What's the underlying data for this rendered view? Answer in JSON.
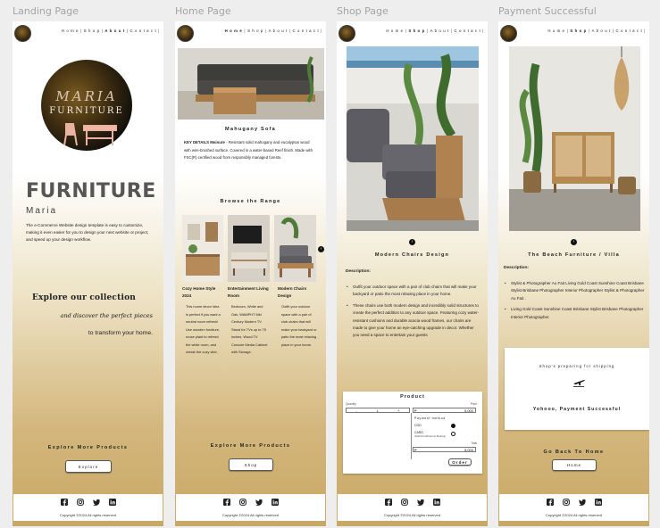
{
  "frames": {
    "landing_title": "Landing Page",
    "home_title": "Home Page",
    "shop_title": "Shop Page",
    "payment_title": "Payment Successful"
  },
  "nav": {
    "home": "H o m e",
    "shop": "S h o p",
    "about": "A b o u t",
    "contact": "C o n t a c t",
    "sep": "|"
  },
  "landing": {
    "logo_word1": "MARIA",
    "logo_word2": "FURNITURE",
    "title": "FURNITURE",
    "subtitle": "Maria",
    "intro": "The e-Commerce Website design template is easy to customize, making it even easier for you to design your next website or project, and speed up your design workflow.",
    "explore_heading": "Explore our collection",
    "explore_script": "and discover the perfect pieces",
    "explore_last": "to transform your home.",
    "more_products": "Explore More Products",
    "explore_button": "Explore"
  },
  "home": {
    "product_title": "Mahugany Sofa",
    "details_label": "KEY DETAILS Moinure",
    "details_text": "- Resistant solid mahogany and eucalyptus wood with wire-brushed surface. Covered in a water-based Reef finish. Made with FSC(R) certified wood from responsibly managed forests.",
    "browse_title": "Browse the Range",
    "col1_title": "Cozy Home Style 2024",
    "col1_text": "This home decor idea is perfect if you want a neutral room refresh! Use wooden furniture, rouse plant to refresh the white room, and create the cozy vibe.",
    "col2_title": "Entertainment Living Room",
    "col2_text": "Bedroom, White and Oak, WAMPHT Mid Century Modern TV Stand for TVs up to 75 inches, Wood TV Console Media Cabinet with Storage.",
    "col3_title": "Modern Chairs Design",
    "col3_text": "Outfit your outdoor space with a pair of club chairs that will make your backyard or patio the most relaxing place in your home.",
    "more_products": "Explore More Products",
    "shop_button": "Shop"
  },
  "shop": {
    "product_title": "Modern Chairs Design",
    "desc_label": "Description:",
    "bullet1": "Outfit your outdoor space with a pair of club chairs that will make your backyard or patio the most relaxing place in your home.",
    "bullet2": "These chairs use both modern design and incredibly solid structures to create the perfect addition to any outdoor space. Featuring cozy water-resistant cushions and durable acacia wood frames, our chairs are made to give your home an eye-catching upgrade in decor. Whether you need a space to entertain your guests",
    "order": {
      "title": "Product",
      "quantity_label": "Quantity",
      "price_label": "Price",
      "minus": "-",
      "qty": "1",
      "plus": "+",
      "price_value": "5,000",
      "payment_label": "Payment method",
      "cod": "COD",
      "card": "CARD",
      "card_sub": "(Debit/Credit/Internet Banking)",
      "total_label": "Total",
      "total_value": "5,000",
      "currency": "₱",
      "order_button": "Order"
    }
  },
  "payment": {
    "product_title": "The Beach Furniture / Villa",
    "desc_label": "Description:",
    "bullet1": "Stylist & Photographer Au Fait Living Gold Coast Sunshine Coast Brisbane Stylist Brisbane Photographer Interior Photographer Stylist & Photographer Au Fait .",
    "bullet2": "Living Gold Coast Sunshine Coast Brisbane Stylist Brisbane Photographer Interior Photographer.",
    "shipping_text": "Shop's preparing for shipping",
    "success_text": "Yohooo, Payment Successful",
    "back_text": "Go Back To Home",
    "home_button": "Home"
  },
  "footer": {
    "copyright": "Copyright ©2024 All rights reserved"
  },
  "icons": [
    "facebook-icon",
    "instagram-icon",
    "twitter-icon",
    "linkedin-icon",
    "airplane-icon",
    "arrow-right-icon"
  ],
  "colors": {
    "gold": "#c8a865",
    "dark": "#111111",
    "grey_title": "#565656"
  }
}
